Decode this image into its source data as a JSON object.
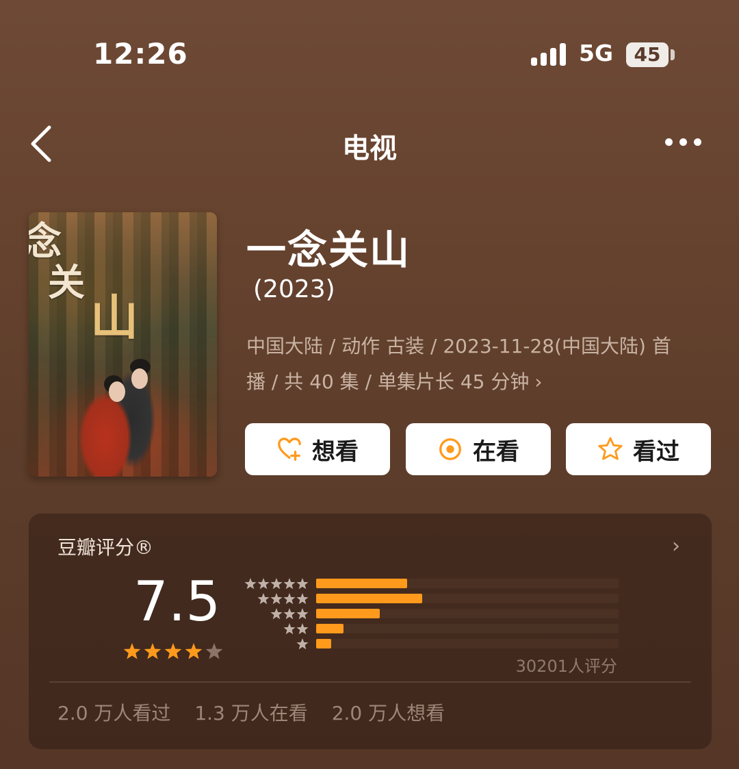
{
  "status_bar": {
    "time": "12:26",
    "network": "5G",
    "battery": "45"
  },
  "nav": {
    "title": "电视"
  },
  "show": {
    "title": "一念关山",
    "year": "(2023)",
    "meta_line1": "中国大陆 / 动作 古装 / 2023-11-28(中国大陆) 首",
    "meta_line2": "播 / 共 40 集 / 单集片长 45 分钟",
    "poster_text": [
      "念",
      "关",
      "山"
    ]
  },
  "actions": {
    "want_label": "想看",
    "watching_label": "在看",
    "watched_label": "看过"
  },
  "rating": {
    "label": "豆瓣评分®",
    "score": "7.5",
    "stars": 4,
    "distribution": [
      {
        "stars": 5,
        "fraction": 0.3
      },
      {
        "stars": 4,
        "fraction": 0.35
      },
      {
        "stars": 3,
        "fraction": 0.21
      },
      {
        "stars": 2,
        "fraction": 0.09
      },
      {
        "stars": 1,
        "fraction": 0.05
      }
    ],
    "count_text": "30201人评分",
    "stats": [
      "2.0 万人看过",
      "1.3 万人在看",
      "2.0 万人想看"
    ]
  },
  "colors": {
    "accent": "#ff9a1c",
    "background": "#66432f"
  }
}
